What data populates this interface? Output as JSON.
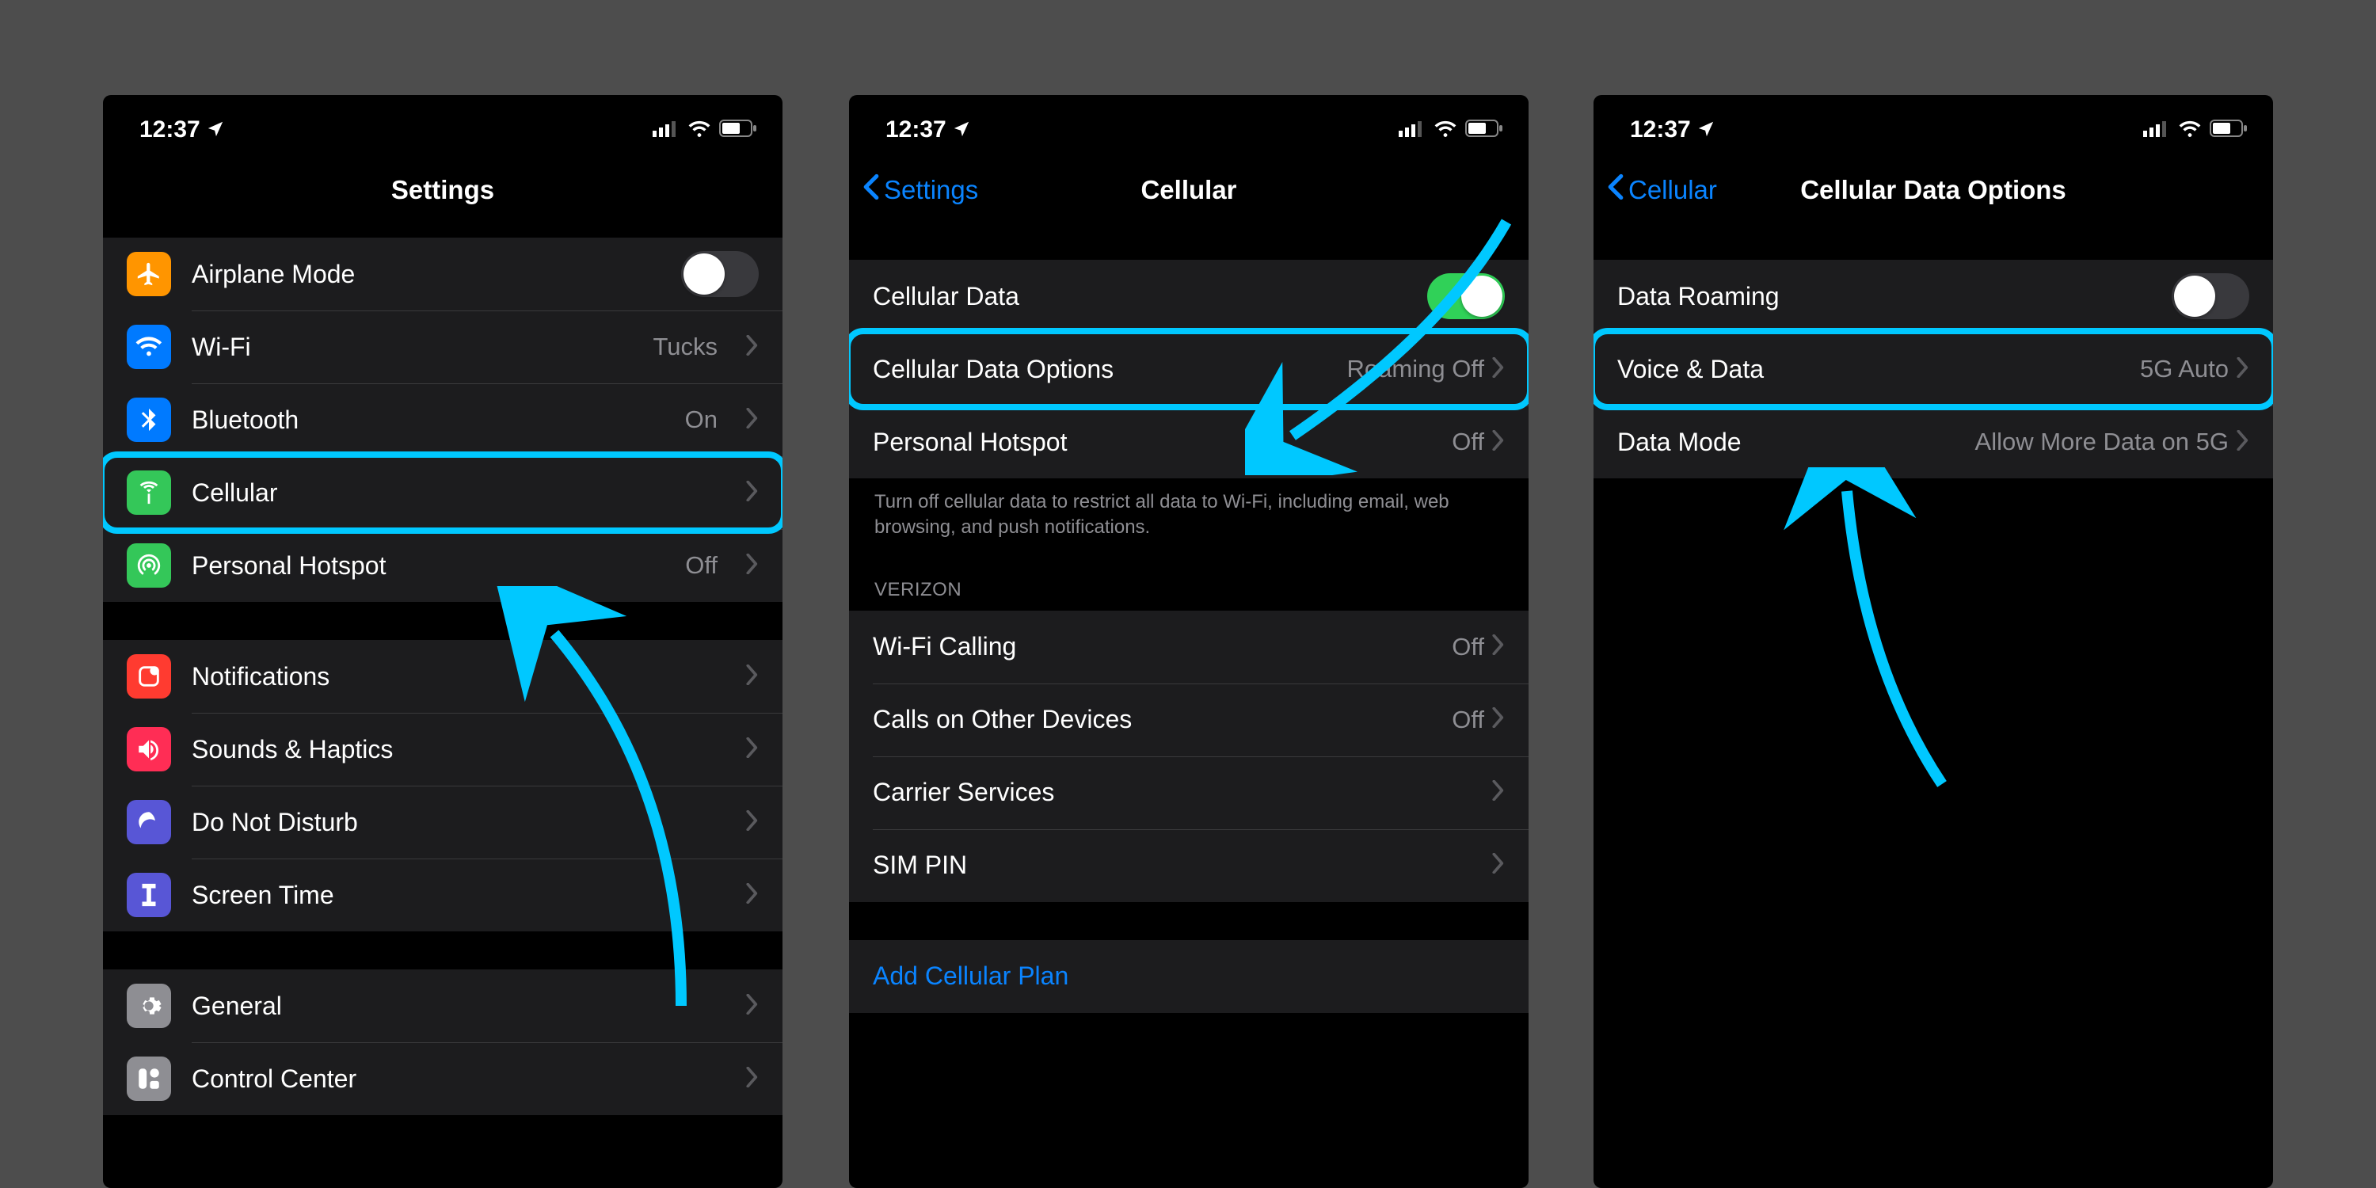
{
  "status": {
    "time": "12:37"
  },
  "screen1": {
    "title": "Settings",
    "rows1": [
      {
        "label": "Airplane Mode",
        "iconColor": "ic-orange",
        "iconName": "airplane-icon",
        "toggle": "off"
      },
      {
        "label": "Wi-Fi",
        "iconColor": "ic-blue",
        "iconName": "wifi-icon",
        "value": "Tucks"
      },
      {
        "label": "Bluetooth",
        "iconColor": "ic-bluetooth",
        "iconName": "bluetooth-icon",
        "value": "On"
      },
      {
        "label": "Cellular",
        "iconColor": "ic-green",
        "iconName": "cellular-icon",
        "highlight": true
      },
      {
        "label": "Personal Hotspot",
        "iconColor": "ic-green",
        "iconName": "hotspot-icon",
        "value": "Off"
      }
    ],
    "rows2": [
      {
        "label": "Notifications",
        "iconColor": "ic-red",
        "iconName": "notifications-icon"
      },
      {
        "label": "Sounds & Haptics",
        "iconColor": "ic-pink",
        "iconName": "sounds-icon"
      },
      {
        "label": "Do Not Disturb",
        "iconColor": "ic-purple",
        "iconName": "dnd-icon"
      },
      {
        "label": "Screen Time",
        "iconColor": "ic-indigo",
        "iconName": "screentime-icon"
      }
    ],
    "rows3": [
      {
        "label": "General",
        "iconColor": "ic-gray",
        "iconName": "gear-icon"
      },
      {
        "label": "Control Center",
        "iconColor": "ic-gray",
        "iconName": "control-center-icon"
      }
    ]
  },
  "screen2": {
    "back": "Settings",
    "title": "Cellular",
    "rows1": [
      {
        "label": "Cellular Data",
        "toggle": "on"
      },
      {
        "label": "Cellular Data Options",
        "value": "Roaming Off",
        "highlight": true
      },
      {
        "label": "Personal Hotspot",
        "value": "Off"
      }
    ],
    "footer1": "Turn off cellular data to restrict all data to Wi-Fi, including email, web browsing, and push notifications.",
    "section2_header": "VERIZON",
    "rows2": [
      {
        "label": "Wi-Fi Calling",
        "value": "Off"
      },
      {
        "label": "Calls on Other Devices",
        "value": "Off"
      },
      {
        "label": "Carrier Services"
      },
      {
        "label": "SIM PIN"
      }
    ],
    "link": "Add Cellular Plan"
  },
  "screen3": {
    "back": "Cellular",
    "title": "Cellular Data Options",
    "rows1": [
      {
        "label": "Data Roaming",
        "toggle": "off"
      },
      {
        "label": "Voice & Data",
        "value": "5G Auto",
        "highlight": true
      },
      {
        "label": "Data Mode",
        "value": "Allow More Data on 5G"
      }
    ]
  }
}
